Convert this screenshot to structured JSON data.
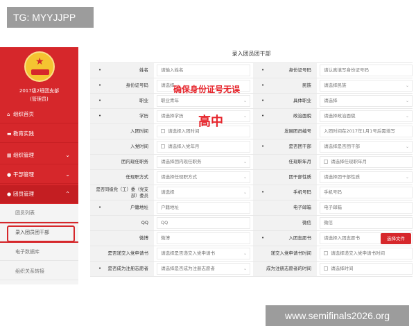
{
  "overlay": {
    "tg_tag": "TG: MYYJJPP",
    "watermark": "www.semifinals2026.org"
  },
  "sidebar": {
    "org_name": "2017级2班团支部",
    "org_role": "(管理员)",
    "nav": [
      {
        "label": "组织首页",
        "icon": "home-icon",
        "expandable": false
      },
      {
        "label": "教育实践",
        "icon": "folder-icon",
        "expandable": false
      },
      {
        "label": "组织管理",
        "icon": "org-icon",
        "expandable": true
      },
      {
        "label": "干部管理",
        "icon": "people-icon",
        "expandable": true
      },
      {
        "label": "团员管理",
        "icon": "people-icon",
        "expandable": true,
        "open": true
      }
    ],
    "sub_items": [
      {
        "label": "团员列表",
        "active": false
      },
      {
        "label": "录入团员团干部",
        "active": true
      },
      {
        "label": "电子数据库",
        "active": false
      },
      {
        "label": "组织关系转接",
        "active": false
      }
    ]
  },
  "main": {
    "title": "录入团员团干部",
    "rows": [
      {
        "l_label": "姓名",
        "l_req": true,
        "l_value": "请输入姓名",
        "l_dd": false,
        "r_label": "身份证号码",
        "r_req": true,
        "r_value": "请认真填写身份证号码",
        "r_dd": false
      },
      {
        "l_label": "身份证号码",
        "l_req": true,
        "l_value": "请选择",
        "l_dd": false,
        "r_label": "民族",
        "r_req": true,
        "r_value": "请选择民族",
        "r_dd": true
      },
      {
        "l_label": "职业",
        "l_req": true,
        "l_value": "职业青年",
        "l_dd": true,
        "r_label": "具体职业",
        "r_req": true,
        "r_value": "请选择",
        "r_dd": true
      },
      {
        "l_label": "学历",
        "l_req": true,
        "l_value": "请选择学历",
        "l_dd": true,
        "r_label": "政治面貌",
        "r_req": true,
        "r_value": "请选择政治面貌",
        "r_dd": true
      },
      {
        "l_label": "入团时间",
        "l_req": false,
        "l_value": "请选择入团时间",
        "l_dd": false,
        "l_cb": true,
        "r_label": "发展团员编号",
        "r_req": false,
        "r_value": "入团时间在2017年1月1号后需填写",
        "r_dd": false
      },
      {
        "l_label": "入党时间",
        "l_req": false,
        "l_value": "请选择入党年月",
        "l_dd": false,
        "l_cb": true,
        "r_label": "是否团干部",
        "r_req": true,
        "r_value": "请选择是否团干部",
        "r_dd": true
      },
      {
        "l_label": "团内现任职务",
        "l_req": false,
        "l_value": "请选择团内现任职务",
        "l_dd": true,
        "r_label": "任现职年月",
        "r_req": false,
        "r_value": "请选择任现职年月",
        "r_dd": false,
        "r_cb": true
      },
      {
        "l_label": "任现职方式",
        "l_req": false,
        "l_value": "请选择任现职方式",
        "l_dd": true,
        "r_label": "团干部性质",
        "r_req": false,
        "r_value": "请选择团干部性质",
        "r_dd": true
      },
      {
        "l_label": "是否同级党（工）委（党支部）委员",
        "l_req": false,
        "l_value": "请选择",
        "l_dd": true,
        "l_two": true,
        "r_label": "手机号码",
        "r_req": true,
        "r_value": "手机号码",
        "r_dd": false
      },
      {
        "l_label": "户籍地址",
        "l_req": true,
        "l_value": "户籍地址",
        "l_dd": false,
        "r_label": "电子邮箱",
        "r_req": false,
        "r_value": "电子邮箱",
        "r_dd": false
      },
      {
        "l_label": "QQ",
        "l_req": false,
        "l_value": "QQ",
        "l_dd": false,
        "r_label": "微信",
        "r_req": false,
        "r_value": "微信",
        "r_dd": false
      },
      {
        "l_label": "微博",
        "l_req": false,
        "l_value": "微博",
        "l_dd": false,
        "r_label": "入团志愿书",
        "r_req": true,
        "r_value": "请选择入团志愿书",
        "r_dd": false,
        "r_btn": "选择文件"
      },
      {
        "l_label": "是否递交入党申请书",
        "l_req": false,
        "l_value": "请选择是否递交入党申请书",
        "l_dd": true,
        "r_label": "递交入党申请书时间",
        "r_req": false,
        "r_value": "请选择递交入党申请书时间",
        "r_dd": false,
        "r_cb": true
      },
      {
        "l_label": "是否成为注册志愿者",
        "l_req": true,
        "l_value": "请选择是否成为注册志愿者",
        "l_dd": true,
        "r_label": "成为注册志愿者的时间",
        "r_req": false,
        "r_value": "请选择时间",
        "r_dd": false,
        "r_cb": true
      }
    ]
  },
  "annotations": {
    "id_note": "确保身份证号无误",
    "edu_note": "高中"
  },
  "colors": {
    "brand_red": "#d6272b",
    "annotation_red": "#e6252c",
    "label_bg": "#f2f2f2"
  }
}
